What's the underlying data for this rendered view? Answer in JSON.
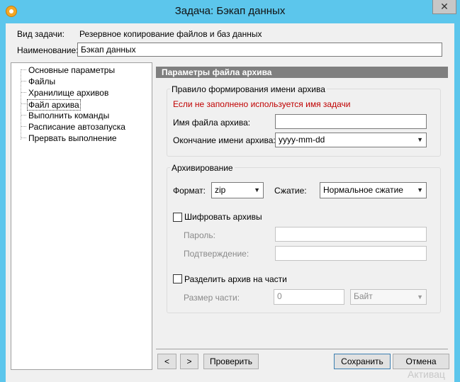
{
  "window": {
    "title": "Задача: Бэкап данных",
    "close_glyph": "✕"
  },
  "task": {
    "type_label": "Вид задачи:",
    "type_value": "Резервное копирование файлов и баз данных",
    "name_label": "Наименование:",
    "name_value": "Бэкап данных"
  },
  "tree": {
    "items": [
      {
        "label": "Основные параметры"
      },
      {
        "label": "Файлы"
      },
      {
        "label": "Хранилище архивов"
      },
      {
        "label": "Файл архива"
      },
      {
        "label": "Выполнить команды"
      },
      {
        "label": "Расписание автозапуска"
      },
      {
        "label": "Прервать выполнение"
      }
    ],
    "selected": "Файл архива"
  },
  "panel": {
    "header": "Параметры файла архива",
    "naming": {
      "title": "Правило формирования имени архива",
      "hint": "Если не заполнено используется имя задачи",
      "hint_color": "#c00000",
      "filename_label": "Имя файла архива:",
      "filename_value": "",
      "suffix_label": "Окончание имени архива:",
      "suffix_value": "yyyy-mm-dd"
    },
    "archiving": {
      "title": "Архивирование",
      "format_label": "Формат:",
      "format_value": "zip",
      "compression_label": "Сжатие:",
      "compression_value": "Нормальное сжатие",
      "encrypt_label": "Шифровать архивы",
      "encrypt_checked": false,
      "password_label": "Пароль:",
      "password_value": "",
      "confirm_label": "Подтверждение:",
      "confirm_value": "",
      "split_label": "Разделить архив на части",
      "split_checked": false,
      "part_size_label": "Размер части:",
      "part_size_value": "0",
      "unit_value": "Байт"
    }
  },
  "footer": {
    "prev_label": "<",
    "next_label": ">",
    "check_label": "Проверить",
    "save_label": "Сохранить",
    "cancel_label": "Отмена"
  },
  "watermark": "Активац"
}
